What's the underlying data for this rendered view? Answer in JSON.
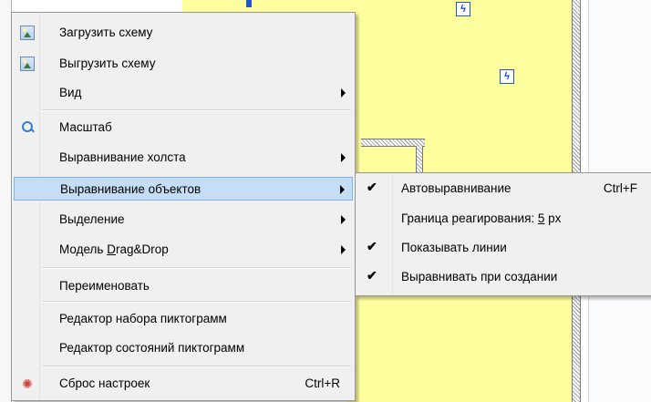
{
  "menu": {
    "items": [
      {
        "label": "Загрузить схему"
      },
      {
        "label": "Выгрузить схему"
      },
      {
        "label": "Вид"
      },
      {
        "label": "Масштаб"
      },
      {
        "label": "Выравнивание холста"
      },
      {
        "label": "Выравнивание объектов"
      },
      {
        "label": "Выделение"
      },
      {
        "label_before": "Модель ",
        "label_u": "D",
        "label_after": "rag&Drop"
      },
      {
        "label": "Переименовать"
      },
      {
        "label": "Редактор набора пиктограмм"
      },
      {
        "label": "Редактор состояний пиктограмм"
      },
      {
        "label": "Сброс настроек",
        "shortcut": "Ctrl+R"
      }
    ]
  },
  "submenu": {
    "items": [
      {
        "label": "Автовыравнивание",
        "shortcut": "Ctrl+F",
        "checked": true
      },
      {
        "label_before": "Граница реагирования: ",
        "label_u": "5",
        "label_after": " px",
        "checked": false
      },
      {
        "label": "Показывать линии",
        "checked": true
      },
      {
        "label": "Выравнивать при создании",
        "checked": true
      }
    ]
  },
  "icons": {
    "load": "image-icon",
    "unload": "image-icon",
    "zoom": "search-icon",
    "reset": "gear-icon",
    "check": "✔"
  },
  "colors": {
    "selection_bg": "#cce8ff",
    "canvas_yellow": "#ffffa0"
  }
}
